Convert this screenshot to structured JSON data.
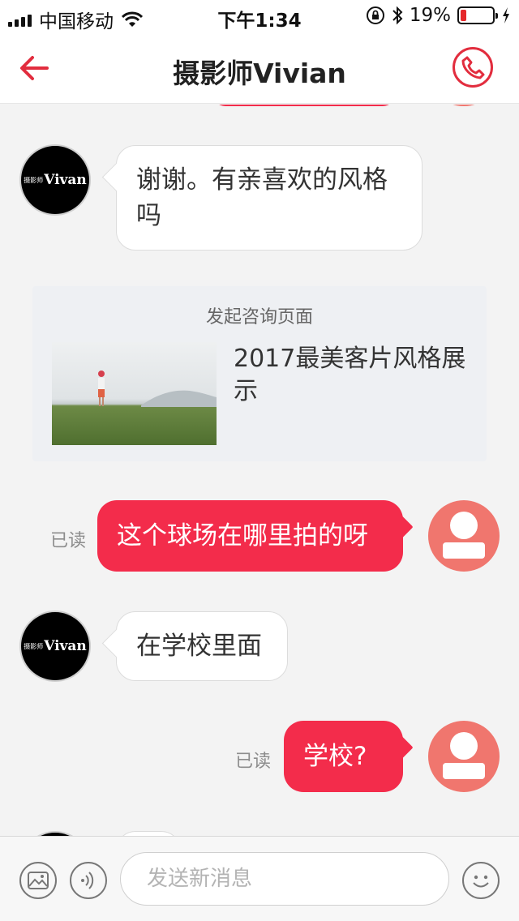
{
  "status_bar": {
    "carrier": "中国移动",
    "time": "下午1:34",
    "battery_percent": "19%",
    "battery_level": 0.19,
    "icons": [
      "signal-icon",
      "wifi-icon",
      "orientation-lock-icon",
      "bluetooth-icon",
      "battery-icon",
      "charging-icon"
    ]
  },
  "nav": {
    "title": "摄影师Vivian",
    "back_icon": "back-arrow-icon",
    "call_icon": "phone-icon",
    "accent": "#e22d3e"
  },
  "messages": [
    {
      "from": "photographer",
      "text": "谢谢。有亲喜欢的风格吗"
    },
    {
      "type": "consult_card",
      "label": "发起咨询页面",
      "title": "2017最美客片风格展示"
    },
    {
      "from": "me",
      "text": "这个球场在哪里拍的呀",
      "status": "已读"
    },
    {
      "from": "photographer",
      "text": "在学校里面"
    },
    {
      "from": "me",
      "text": "学校?",
      "status": "已读"
    }
  ],
  "avatar_vivan": {
    "small": "摄影师",
    "big": "Vivan"
  },
  "input": {
    "placeholder": "发送新消息",
    "image_icon": "image-icon",
    "voice_icon": "voice-icon",
    "emoji_icon": "emoji-icon"
  },
  "colors": {
    "outgoing_bubble": "#f32c4b",
    "user_avatar": "#f0766e"
  }
}
